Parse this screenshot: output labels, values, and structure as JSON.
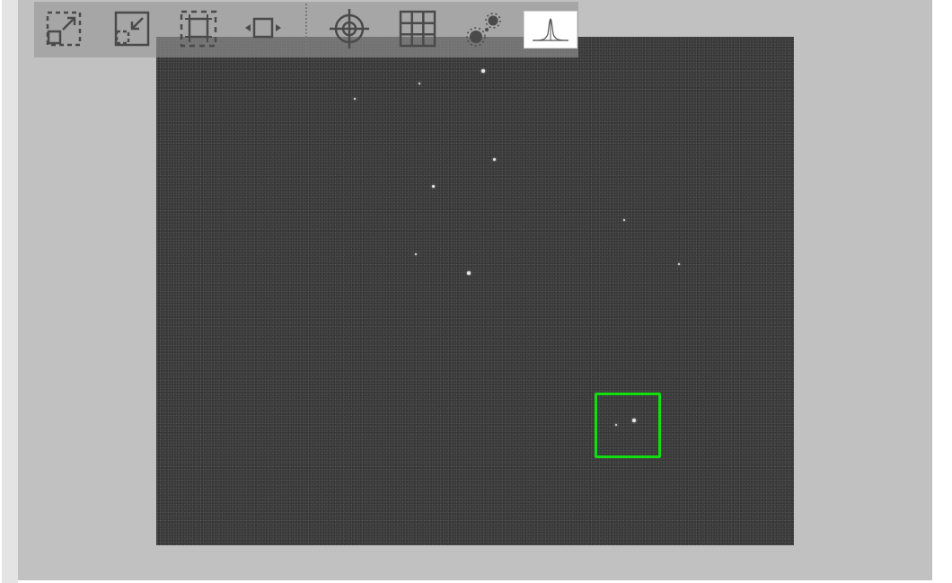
{
  "toolbar": {
    "buttons": [
      {
        "id": "expand-to-fit",
        "icon": "expand-arrows-icon"
      },
      {
        "id": "shrink-to-fit",
        "icon": "shrink-arrows-icon"
      },
      {
        "id": "fit-frame",
        "icon": "fit-frame-icon"
      },
      {
        "id": "fit-width",
        "icon": "fit-width-icon"
      },
      {
        "id": "crosshair",
        "icon": "crosshair-icon"
      },
      {
        "id": "grid",
        "icon": "grid-icon"
      },
      {
        "id": "star-detect",
        "icon": "stars-icon"
      },
      {
        "id": "histogram",
        "icon": "histogram-icon",
        "active": true
      }
    ]
  },
  "image_view": {
    "selection_box_color": "#11dd11",
    "background": "#3b3b3b"
  },
  "colors": {
    "viewport_bg": "#c1c1c1",
    "toolbar_bg": "#969696",
    "roi": "#11dd11"
  }
}
